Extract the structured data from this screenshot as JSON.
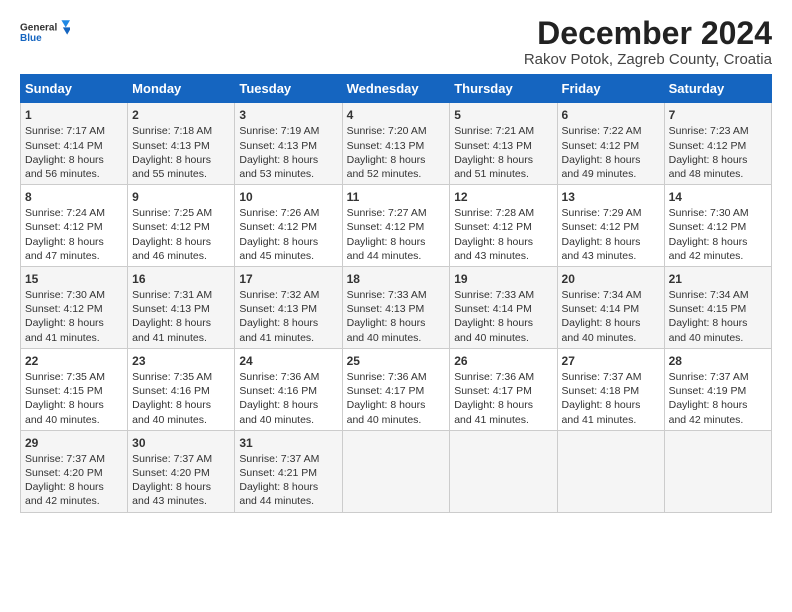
{
  "header": {
    "logo_general": "General",
    "logo_blue": "Blue",
    "main_title": "December 2024",
    "subtitle": "Rakov Potok, Zagreb County, Croatia"
  },
  "calendar": {
    "days": [
      "Sunday",
      "Monday",
      "Tuesday",
      "Wednesday",
      "Thursday",
      "Friday",
      "Saturday"
    ],
    "weeks": [
      [
        {
          "num": "1",
          "sunrise": "Sunrise: 7:17 AM",
          "sunset": "Sunset: 4:14 PM",
          "daylight": "Daylight: 8 hours and 56 minutes."
        },
        {
          "num": "2",
          "sunrise": "Sunrise: 7:18 AM",
          "sunset": "Sunset: 4:13 PM",
          "daylight": "Daylight: 8 hours and 55 minutes."
        },
        {
          "num": "3",
          "sunrise": "Sunrise: 7:19 AM",
          "sunset": "Sunset: 4:13 PM",
          "daylight": "Daylight: 8 hours and 53 minutes."
        },
        {
          "num": "4",
          "sunrise": "Sunrise: 7:20 AM",
          "sunset": "Sunset: 4:13 PM",
          "daylight": "Daylight: 8 hours and 52 minutes."
        },
        {
          "num": "5",
          "sunrise": "Sunrise: 7:21 AM",
          "sunset": "Sunset: 4:13 PM",
          "daylight": "Daylight: 8 hours and 51 minutes."
        },
        {
          "num": "6",
          "sunrise": "Sunrise: 7:22 AM",
          "sunset": "Sunset: 4:12 PM",
          "daylight": "Daylight: 8 hours and 49 minutes."
        },
        {
          "num": "7",
          "sunrise": "Sunrise: 7:23 AM",
          "sunset": "Sunset: 4:12 PM",
          "daylight": "Daylight: 8 hours and 48 minutes."
        }
      ],
      [
        {
          "num": "8",
          "sunrise": "Sunrise: 7:24 AM",
          "sunset": "Sunset: 4:12 PM",
          "daylight": "Daylight: 8 hours and 47 minutes."
        },
        {
          "num": "9",
          "sunrise": "Sunrise: 7:25 AM",
          "sunset": "Sunset: 4:12 PM",
          "daylight": "Daylight: 8 hours and 46 minutes."
        },
        {
          "num": "10",
          "sunrise": "Sunrise: 7:26 AM",
          "sunset": "Sunset: 4:12 PM",
          "daylight": "Daylight: 8 hours and 45 minutes."
        },
        {
          "num": "11",
          "sunrise": "Sunrise: 7:27 AM",
          "sunset": "Sunset: 4:12 PM",
          "daylight": "Daylight: 8 hours and 44 minutes."
        },
        {
          "num": "12",
          "sunrise": "Sunrise: 7:28 AM",
          "sunset": "Sunset: 4:12 PM",
          "daylight": "Daylight: 8 hours and 43 minutes."
        },
        {
          "num": "13",
          "sunrise": "Sunrise: 7:29 AM",
          "sunset": "Sunset: 4:12 PM",
          "daylight": "Daylight: 8 hours and 43 minutes."
        },
        {
          "num": "14",
          "sunrise": "Sunrise: 7:30 AM",
          "sunset": "Sunset: 4:12 PM",
          "daylight": "Daylight: 8 hours and 42 minutes."
        }
      ],
      [
        {
          "num": "15",
          "sunrise": "Sunrise: 7:30 AM",
          "sunset": "Sunset: 4:12 PM",
          "daylight": "Daylight: 8 hours and 41 minutes."
        },
        {
          "num": "16",
          "sunrise": "Sunrise: 7:31 AM",
          "sunset": "Sunset: 4:13 PM",
          "daylight": "Daylight: 8 hours and 41 minutes."
        },
        {
          "num": "17",
          "sunrise": "Sunrise: 7:32 AM",
          "sunset": "Sunset: 4:13 PM",
          "daylight": "Daylight: 8 hours and 41 minutes."
        },
        {
          "num": "18",
          "sunrise": "Sunrise: 7:33 AM",
          "sunset": "Sunset: 4:13 PM",
          "daylight": "Daylight: 8 hours and 40 minutes."
        },
        {
          "num": "19",
          "sunrise": "Sunrise: 7:33 AM",
          "sunset": "Sunset: 4:14 PM",
          "daylight": "Daylight: 8 hours and 40 minutes."
        },
        {
          "num": "20",
          "sunrise": "Sunrise: 7:34 AM",
          "sunset": "Sunset: 4:14 PM",
          "daylight": "Daylight: 8 hours and 40 minutes."
        },
        {
          "num": "21",
          "sunrise": "Sunrise: 7:34 AM",
          "sunset": "Sunset: 4:15 PM",
          "daylight": "Daylight: 8 hours and 40 minutes."
        }
      ],
      [
        {
          "num": "22",
          "sunrise": "Sunrise: 7:35 AM",
          "sunset": "Sunset: 4:15 PM",
          "daylight": "Daylight: 8 hours and 40 minutes."
        },
        {
          "num": "23",
          "sunrise": "Sunrise: 7:35 AM",
          "sunset": "Sunset: 4:16 PM",
          "daylight": "Daylight: 8 hours and 40 minutes."
        },
        {
          "num": "24",
          "sunrise": "Sunrise: 7:36 AM",
          "sunset": "Sunset: 4:16 PM",
          "daylight": "Daylight: 8 hours and 40 minutes."
        },
        {
          "num": "25",
          "sunrise": "Sunrise: 7:36 AM",
          "sunset": "Sunset: 4:17 PM",
          "daylight": "Daylight: 8 hours and 40 minutes."
        },
        {
          "num": "26",
          "sunrise": "Sunrise: 7:36 AM",
          "sunset": "Sunset: 4:17 PM",
          "daylight": "Daylight: 8 hours and 41 minutes."
        },
        {
          "num": "27",
          "sunrise": "Sunrise: 7:37 AM",
          "sunset": "Sunset: 4:18 PM",
          "daylight": "Daylight: 8 hours and 41 minutes."
        },
        {
          "num": "28",
          "sunrise": "Sunrise: 7:37 AM",
          "sunset": "Sunset: 4:19 PM",
          "daylight": "Daylight: 8 hours and 42 minutes."
        }
      ],
      [
        {
          "num": "29",
          "sunrise": "Sunrise: 7:37 AM",
          "sunset": "Sunset: 4:20 PM",
          "daylight": "Daylight: 8 hours and 42 minutes."
        },
        {
          "num": "30",
          "sunrise": "Sunrise: 7:37 AM",
          "sunset": "Sunset: 4:20 PM",
          "daylight": "Daylight: 8 hours and 43 minutes."
        },
        {
          "num": "31",
          "sunrise": "Sunrise: 7:37 AM",
          "sunset": "Sunset: 4:21 PM",
          "daylight": "Daylight: 8 hours and 44 minutes."
        },
        null,
        null,
        null,
        null
      ]
    ]
  }
}
